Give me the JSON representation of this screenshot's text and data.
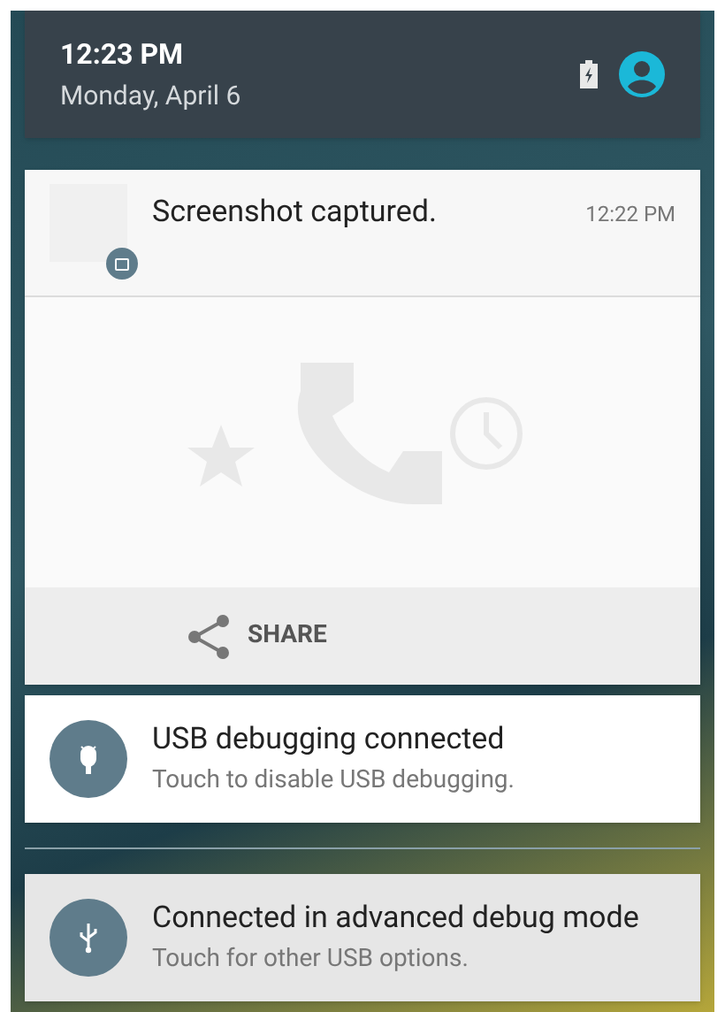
{
  "header": {
    "time": "12:23 PM",
    "date": "Monday, April 6"
  },
  "screenshot_notification": {
    "title": "Screenshot captured.",
    "time": "12:22 PM",
    "action": "SHARE"
  },
  "notifications": [
    {
      "title": "USB debugging connected",
      "text": "Touch to disable USB debugging.",
      "kind": "debugging",
      "highlighted": false
    },
    {
      "title": "Connected in advanced debug mode",
      "text": "Touch for other USB options.",
      "kind": "connection",
      "highlighted": true
    }
  ]
}
